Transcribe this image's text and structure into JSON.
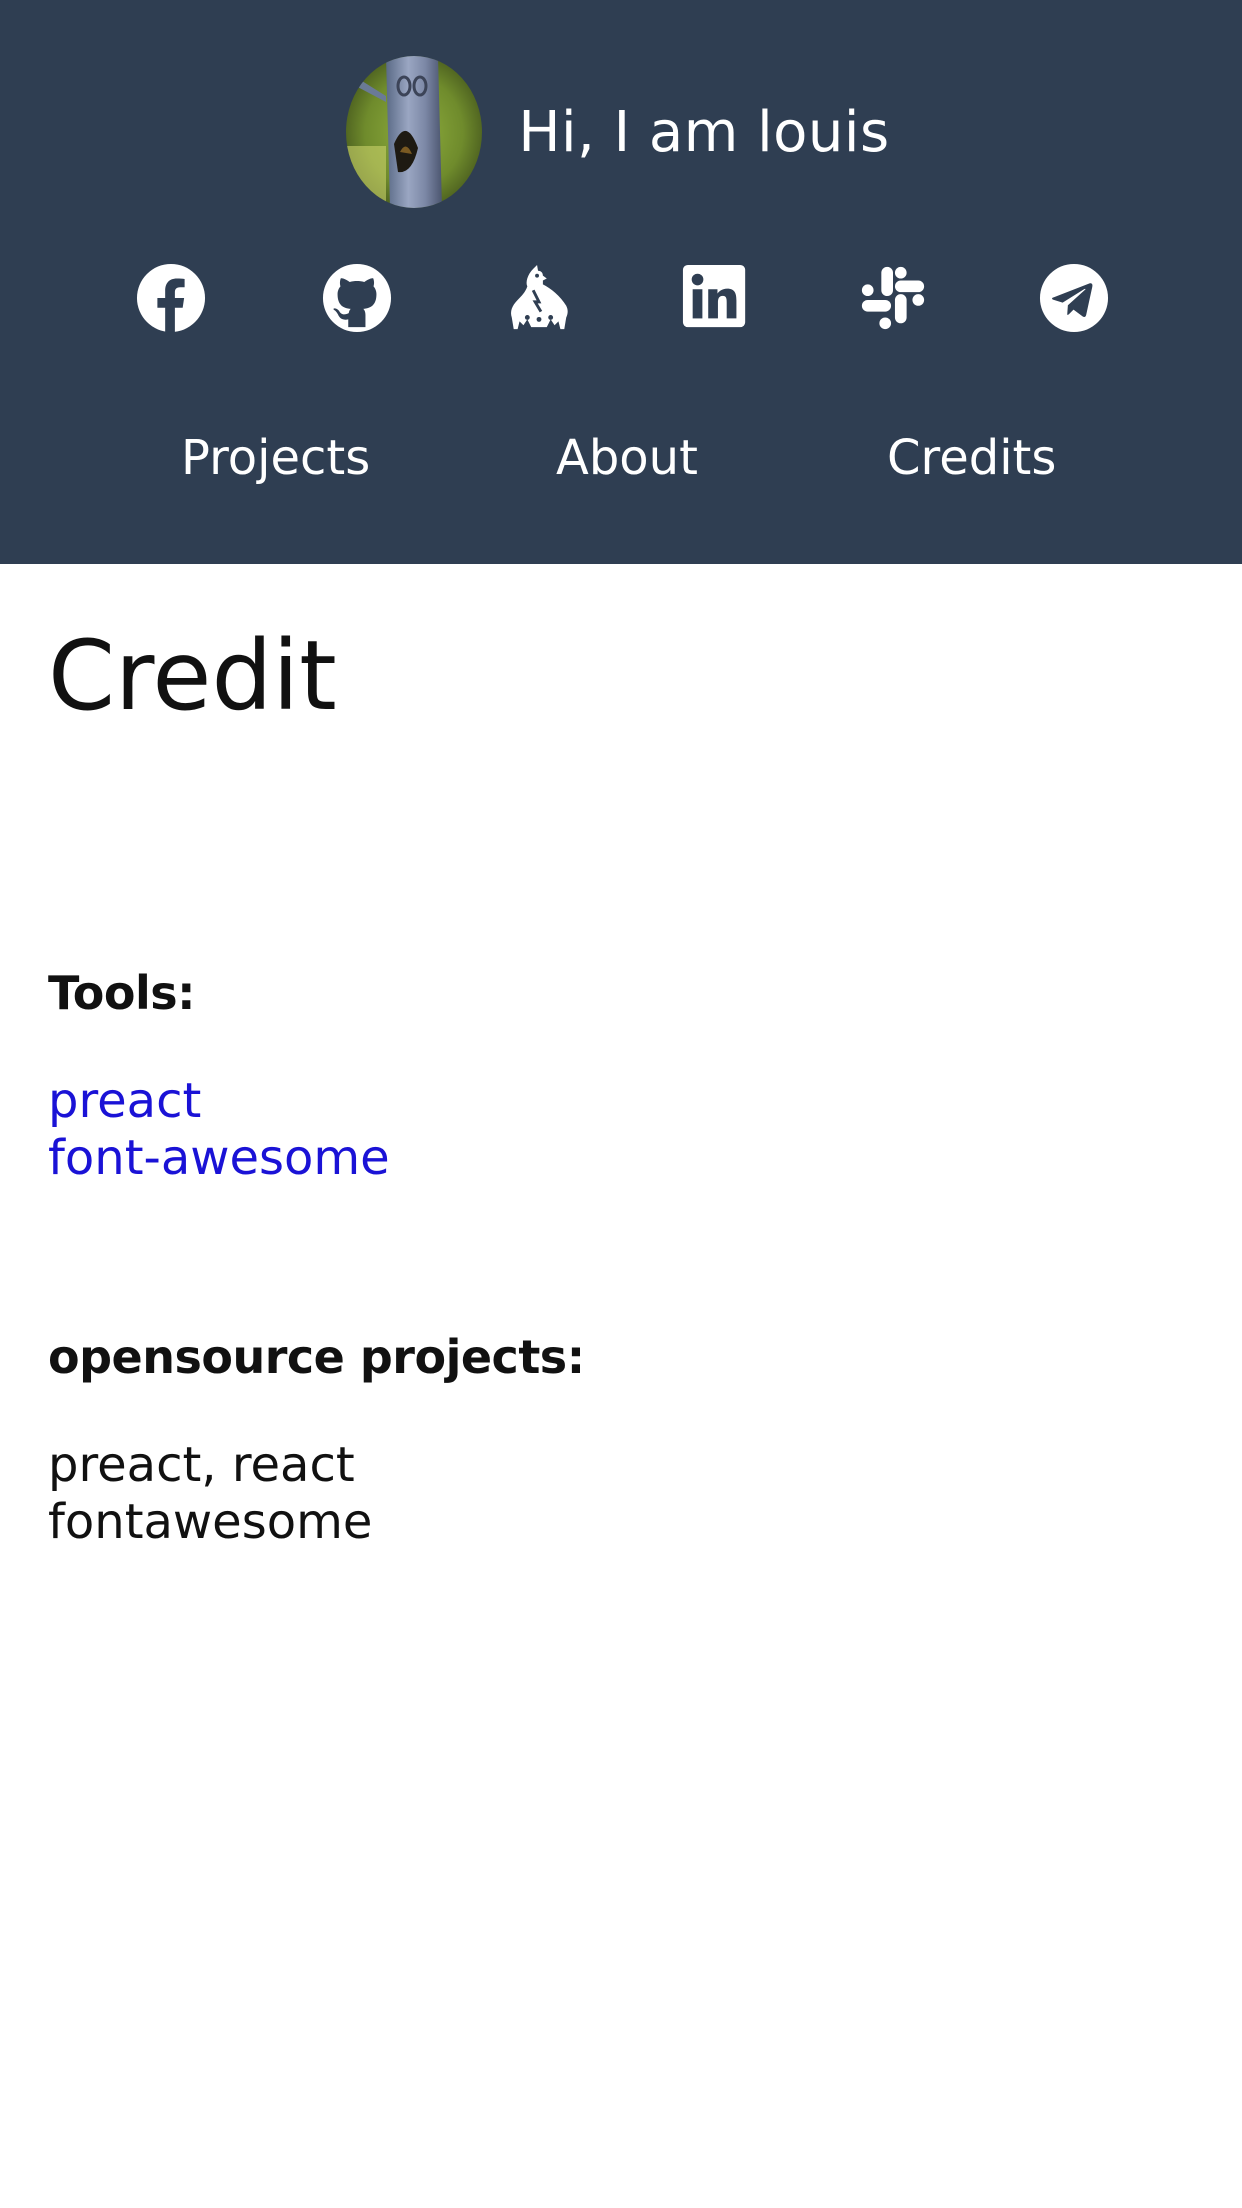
{
  "header": {
    "greeting": "Hi, I am louis",
    "avatar_alt": "profile photo",
    "socials": [
      {
        "icon": "facebook-icon"
      },
      {
        "icon": "github-icon"
      },
      {
        "icon": "mascot-icon"
      },
      {
        "icon": "linkedin-icon"
      },
      {
        "icon": "slack-icon"
      },
      {
        "icon": "telegram-icon"
      }
    ],
    "nav": [
      "Projects",
      "About",
      "Credits"
    ]
  },
  "main": {
    "title": "Credit",
    "tools_heading": "Tools:",
    "tools": [
      "preact",
      "font-awesome"
    ],
    "opensource_heading": "opensource projects:",
    "opensource": [
      "preact, react",
      "fontawesome"
    ]
  },
  "colors": {
    "header_bg": "#2f3e52",
    "link": "#1a12d6",
    "text": "#111111",
    "header_text": "#ffffff"
  }
}
